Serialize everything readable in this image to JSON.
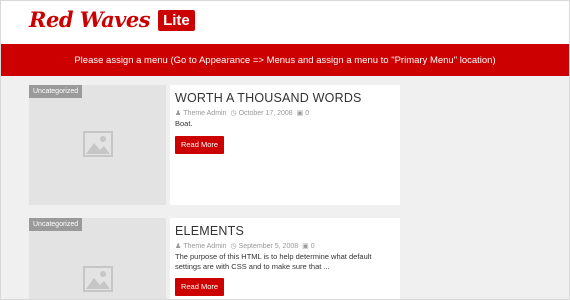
{
  "header": {
    "logo_main": "Red Waves",
    "logo_badge": "Lite"
  },
  "menu_bar": {
    "text": "Please assign a menu (Go to Appearance => Menus and assign a menu to \"Primary Menu\" location)"
  },
  "posts": [
    {
      "category": "Uncategorized",
      "title": "WORTH A THOUSAND WORDS",
      "author": "Theme Admin",
      "date": "October 17, 2008",
      "comments": "0",
      "excerpt": "Boat.",
      "read_more": "Read More"
    },
    {
      "category": "Uncategorized",
      "title": "ELEMENTS",
      "author": "Theme Admin",
      "date": "September 5, 2008",
      "comments": "0",
      "excerpt": "The purpose of this HTML is to help determine what default settings are with CSS and to make sure that ...",
      "read_more": "Read More"
    }
  ],
  "colors": {
    "accent": "#cc0000",
    "badge": "#9a9a9a",
    "thumb_bg": "#e3e3e3",
    "page_bg": "#f0f0f0"
  },
  "icons": {
    "thumbnail": "image-placeholder-icon",
    "author": "user-icon",
    "date": "clock-icon",
    "comments": "comment-icon"
  }
}
